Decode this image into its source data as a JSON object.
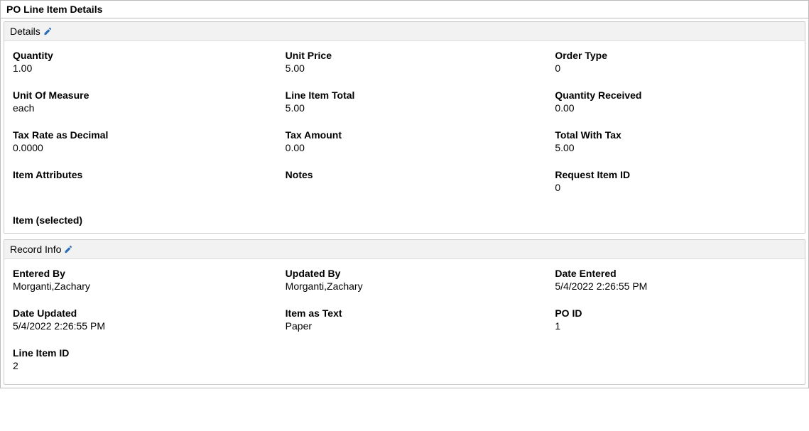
{
  "panel": {
    "title": "PO Line Item Details"
  },
  "sections": {
    "details": {
      "title": "Details",
      "fields": {
        "quantity": {
          "label": "Quantity",
          "value": "1.00"
        },
        "unit_price": {
          "label": "Unit Price",
          "value": "5.00"
        },
        "order_type": {
          "label": "Order Type",
          "value": "0"
        },
        "uom": {
          "label": "Unit Of Measure",
          "value": "each"
        },
        "line_total": {
          "label": "Line Item Total",
          "value": "5.00"
        },
        "qty_received": {
          "label": "Quantity Received",
          "value": "0.00"
        },
        "tax_rate": {
          "label": "Tax Rate as Decimal",
          "value": "0.0000"
        },
        "tax_amount": {
          "label": "Tax Amount",
          "value": "0.00"
        },
        "total_with_tax": {
          "label": "Total With Tax",
          "value": "5.00"
        },
        "item_attributes": {
          "label": "Item Attributes",
          "value": ""
        },
        "notes": {
          "label": "Notes",
          "value": ""
        },
        "request_item_id": {
          "label": "Request Item ID",
          "value": "0"
        },
        "item_selected": {
          "label": "Item (selected)",
          "value": ""
        }
      }
    },
    "record_info": {
      "title": "Record Info",
      "fields": {
        "entered_by": {
          "label": "Entered By",
          "value": "Morganti,Zachary"
        },
        "updated_by": {
          "label": "Updated By",
          "value": "Morganti,Zachary"
        },
        "date_entered": {
          "label": "Date Entered",
          "value": "5/4/2022 2:26:55 PM"
        },
        "date_updated": {
          "label": "Date Updated",
          "value": "5/4/2022 2:26:55 PM"
        },
        "item_as_text": {
          "label": "Item as Text",
          "value": "Paper"
        },
        "po_id": {
          "label": "PO ID",
          "value": "1"
        },
        "line_item_id": {
          "label": "Line Item ID",
          "value": "2"
        }
      }
    }
  }
}
